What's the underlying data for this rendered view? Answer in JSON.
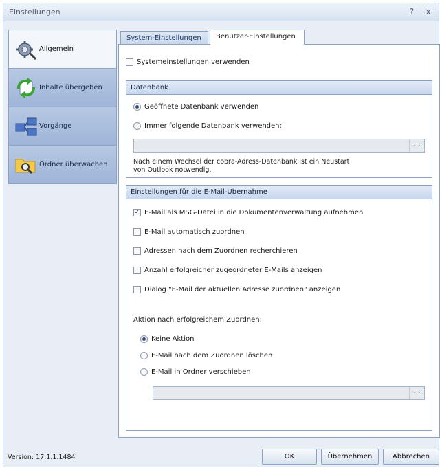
{
  "window": {
    "title": "Einstellungen",
    "help_glyph": "?",
    "close_glyph": "x"
  },
  "sidebar": {
    "items": [
      {
        "label": "Allgemein",
        "icon": "gear-icon",
        "active": true
      },
      {
        "label": "Inhalte übergeben",
        "icon": "transfer-arrows-icon",
        "active": false
      },
      {
        "label": "Vorgänge",
        "icon": "process-blocks-icon",
        "active": false
      },
      {
        "label": "Ordner überwachen",
        "icon": "folder-search-icon",
        "active": false
      }
    ]
  },
  "tabs": [
    {
      "label": "System-Einstellungen",
      "active": false
    },
    {
      "label": "Benutzer-Einstellungen",
      "active": true
    }
  ],
  "use_system_settings": {
    "label": "Systemeinstellungen verwenden",
    "checked": false
  },
  "datenbank": {
    "header": "Datenbank",
    "options": [
      {
        "label": "Geöffnete Datenbank verwenden",
        "selected": true
      },
      {
        "label": "Immer folgende Datenbank verwenden:",
        "selected": false
      }
    ],
    "path_value": "",
    "browse_label": "...",
    "note_line1": "Nach einem Wechsel der cobra-Adress-Datenbank ist ein Neustart",
    "note_line2": "von Outlook notwendig."
  },
  "email": {
    "header": "Einstellungen für die E-Mail-Übernahme",
    "checks": [
      {
        "label": "E-Mail als MSG-Datei in die Dokumentenverwaltung aufnehmen",
        "checked": true
      },
      {
        "label": "E-Mail automatisch zuordnen",
        "checked": false
      },
      {
        "label": "Adressen nach dem Zuordnen recherchieren",
        "checked": false
      },
      {
        "label": "Anzahl erfolgreicher zugeordneter E-Mails anzeigen",
        "checked": false
      },
      {
        "label": "Dialog \"E-Mail der aktuellen Adresse zuordnen\" anzeigen",
        "checked": false
      }
    ],
    "action_label": "Aktion nach erfolgreichem Zuordnen:",
    "actions": [
      {
        "label": "Keine Aktion",
        "selected": true
      },
      {
        "label": "E-Mail nach dem Zuordnen löschen",
        "selected": false
      },
      {
        "label": "E-Mail in Ordner verschieben",
        "selected": false
      }
    ],
    "folder_value": "",
    "folder_browse_label": "..."
  },
  "footer": {
    "version": "Version: 17.1.1.1484",
    "ok": "OK",
    "apply": "Übernehmen",
    "cancel": "Abbrechen"
  },
  "check_glyph": "✓"
}
